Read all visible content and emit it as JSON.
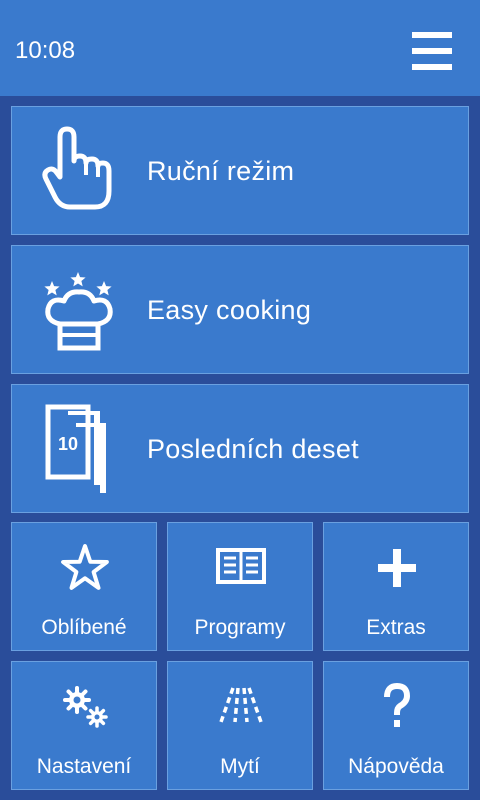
{
  "status_bar": {
    "time": "10:08"
  },
  "header": {
    "menu_icon": "hamburger-menu-icon"
  },
  "main_tiles": [
    {
      "label": "Ruční režim",
      "icon": "hand-pointer-icon"
    },
    {
      "label": "Easy cooking",
      "icon": "chef-hat-stars-icon"
    },
    {
      "label": "Posledních deset",
      "icon": "stacked-cards-icon",
      "badge": "10"
    }
  ],
  "grid_tiles": [
    {
      "label": "Oblíbené",
      "icon": "star-outline-icon"
    },
    {
      "label": "Programy",
      "icon": "open-book-icon"
    },
    {
      "label": "Extras",
      "icon": "plus-icon"
    },
    {
      "label": "Nastavení",
      "icon": "gears-icon"
    },
    {
      "label": "Mytí",
      "icon": "spray-jets-icon"
    },
    {
      "label": "Nápověda",
      "icon": "question-mark-icon"
    }
  ],
  "colors": {
    "background": "#2a4d9a",
    "tile": "#3a7acd",
    "tile_border": "#6aa0e0",
    "text": "#ffffff"
  }
}
